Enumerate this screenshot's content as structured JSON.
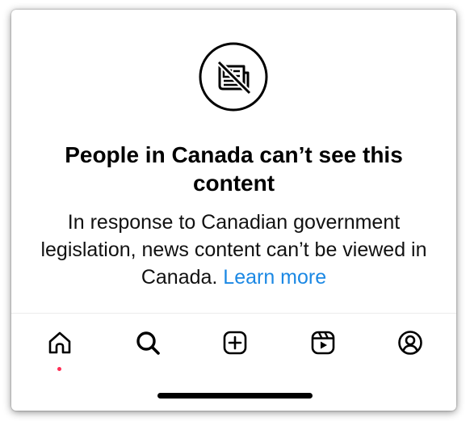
{
  "notice": {
    "headline": "People in Canada can’t see this content",
    "body": "In response to Canadian government legislation, news content can’t be viewed in Canada. ",
    "learn_more_label": "Learn more",
    "icon": "news-blocked-icon"
  },
  "nav": {
    "items": [
      {
        "name": "home",
        "icon": "home-icon",
        "active": true
      },
      {
        "name": "search",
        "icon": "search-icon",
        "active": false
      },
      {
        "name": "create",
        "icon": "plus-square-icon",
        "active": false
      },
      {
        "name": "reels",
        "icon": "reels-icon",
        "active": false
      },
      {
        "name": "profile",
        "icon": "profile-icon",
        "active": false
      }
    ],
    "notification_dot_color": "#ff2d55"
  },
  "colors": {
    "link": "#1b88e4",
    "text": "#000000",
    "background": "#ffffff"
  }
}
